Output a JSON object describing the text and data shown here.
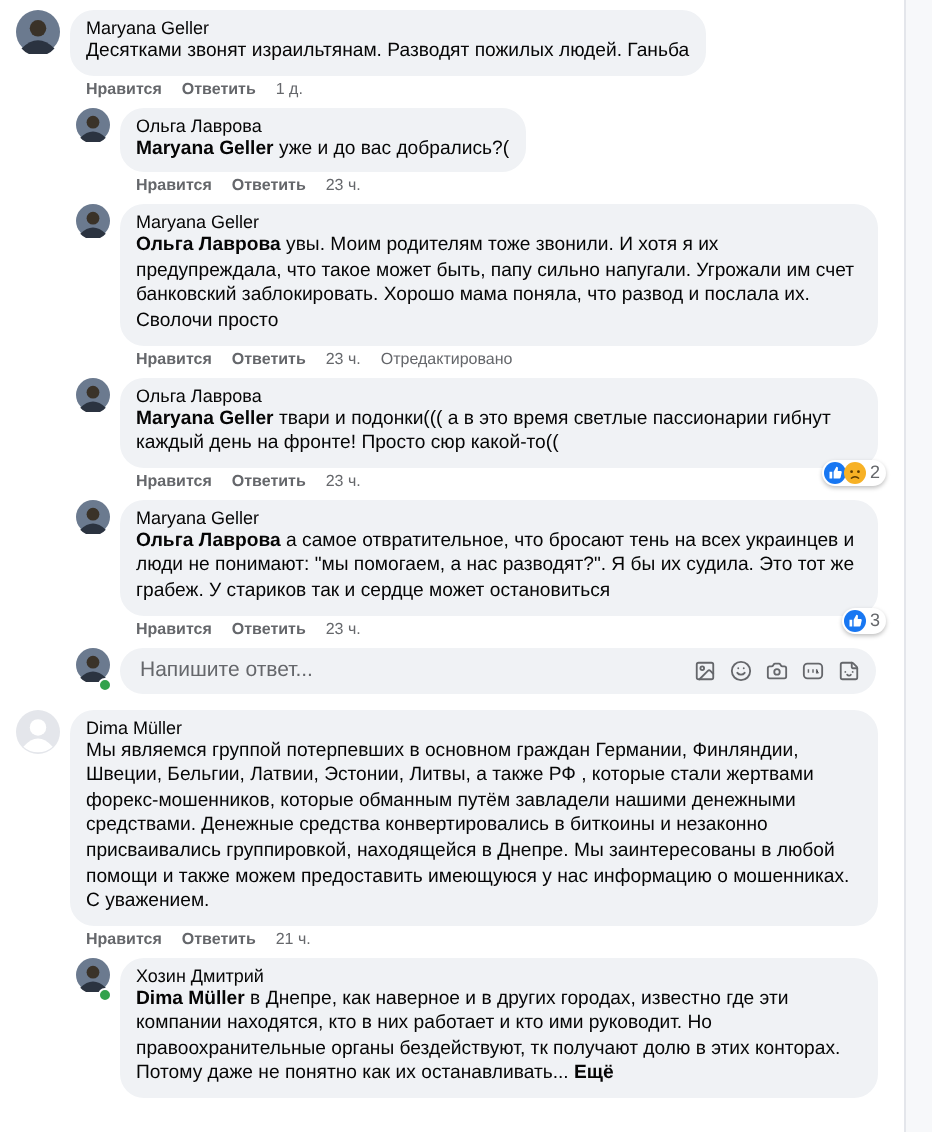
{
  "comments": [
    {
      "author": "Maryana Geller",
      "avatar": {
        "kind": "photo"
      },
      "online": false,
      "text": "Десятками звонят израильтянам. Разводят пожилых людей. Ганьба",
      "actions": {
        "like": "Нравится",
        "reply": "Ответить",
        "time": "1 д."
      },
      "replies": [
        {
          "author": "Ольга Лаврова",
          "avatar": {
            "kind": "photo"
          },
          "online": false,
          "text": "**Maryana Geller** уже и до вас добрались?(",
          "actions": {
            "like": "Нравится",
            "reply": "Ответить",
            "time": "23 ч."
          }
        },
        {
          "author": "Maryana Geller",
          "avatar": {
            "kind": "photo"
          },
          "online": false,
          "text": "**Ольга Лаврова** увы. Моим родителям тоже звонили. И хотя я их предупреждала, что такое может быть, папу сильно напугали. Угрожали им счет банковский заблокировать. Хорошо мама поняла, что развод и послала их. Сволочи просто",
          "actions": {
            "like": "Нравится",
            "reply": "Ответить",
            "time": "23 ч.",
            "edited": "Отредактировано"
          }
        },
        {
          "author": "Ольга Лаврова",
          "avatar": {
            "kind": "photo"
          },
          "online": false,
          "text": "**Maryana Geller** твари и подонки((( а в это время светлые пассионарии гибнут каждый день на фронте! Просто сюр какой-то((",
          "actions": {
            "like": "Нравится",
            "reply": "Ответить",
            "time": "23 ч."
          },
          "reactions": {
            "icons": [
              {
                "kind": "like"
              },
              {
                "kind": "sad"
              }
            ],
            "count": "2"
          }
        },
        {
          "author": "Maryana Geller",
          "avatar": {
            "kind": "photo"
          },
          "online": false,
          "text": "**Ольга Лаврова** а самое отвратительное, что бросают тень на всех украинцев и люди не понимают: \"мы помогаем, а нас разводят?\". Я бы их судила. Это тот же грабеж. У стариков так и сердце может остановиться",
          "actions": {
            "like": "Нравится",
            "reply": "Ответить",
            "time": "23 ч."
          },
          "reactions": {
            "icons": [
              {
                "kind": "like"
              }
            ],
            "count": "3"
          }
        }
      ],
      "composer": {
        "placeholder": "Напишите ответ...",
        "online": true
      }
    },
    {
      "author": "Dima Müller",
      "avatar": {
        "kind": "default"
      },
      "online": false,
      "text": "Мы являемся группой потерпевших в основном граждан Германии, Финляндии, Швеции, Бельгии, Латвии, Эстонии, Литвы, а также РФ , которые стали жертвами форекс-мошенников, которые обманным путём завладели нашими денежными средствами. Денежные средства конвертировались в биткоины и незаконно присваивались группировкой, находящейся в Днепре. Мы заинтересованы в любой помощи и также можем предоставить имеющуюся у нас информацию о мошенниках. С уважением.",
      "actions": {
        "like": "Нравится",
        "reply": "Ответить",
        "time": "21 ч."
      },
      "replies": [
        {
          "author": "Хозин Дмитрий",
          "avatar": {
            "kind": "photo"
          },
          "online": true,
          "text": "**Dima Müller** в Днепре, как наверное и в других городах, известно где эти компании находятся, кто в них работает и кто ими руководит. Но правоохранительные органы бездействуют, тк получают долю в этих конторах. Потому даже не понятно как их останавливать...",
          "more": "Ещё"
        }
      ]
    }
  ]
}
